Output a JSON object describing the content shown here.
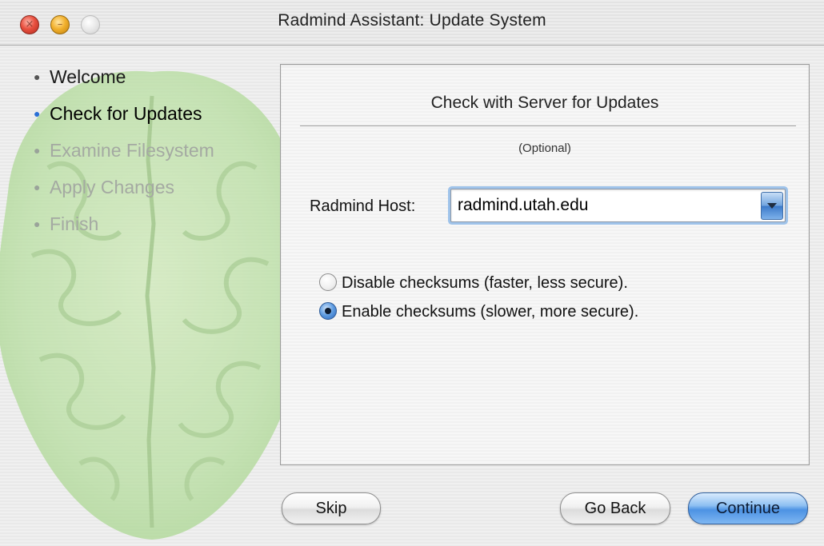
{
  "window": {
    "title": "Radmind Assistant: Update System"
  },
  "steps": [
    {
      "label": "Welcome",
      "state": "done",
      "icon": "step-done-icon"
    },
    {
      "label": "Check for Updates",
      "state": "current",
      "icon": "step-current-icon"
    },
    {
      "label": "Examine Filesystem",
      "state": "pending",
      "icon": "step-pending-icon"
    },
    {
      "label": "Apply Changes",
      "state": "pending",
      "icon": "step-pending-icon"
    },
    {
      "label": "Finish",
      "state": "pending",
      "icon": "step-pending-icon"
    }
  ],
  "panel": {
    "heading": "Check with Server for Updates",
    "optional_note": "(Optional)",
    "host_label": "Radmind Host:",
    "host_value": "radmind.utah.edu",
    "checksum_options": [
      {
        "label": "Disable checksums (faster, less secure).",
        "selected": false
      },
      {
        "label": "Enable checksums (slower, more secure).",
        "selected": true
      }
    ]
  },
  "buttons": {
    "skip": "Skip",
    "go_back": "Go Back",
    "continue": "Continue"
  },
  "colors": {
    "accent": "#4c92e3",
    "brain": "#b5dc9b",
    "pending_step": "#a4a9a2"
  }
}
